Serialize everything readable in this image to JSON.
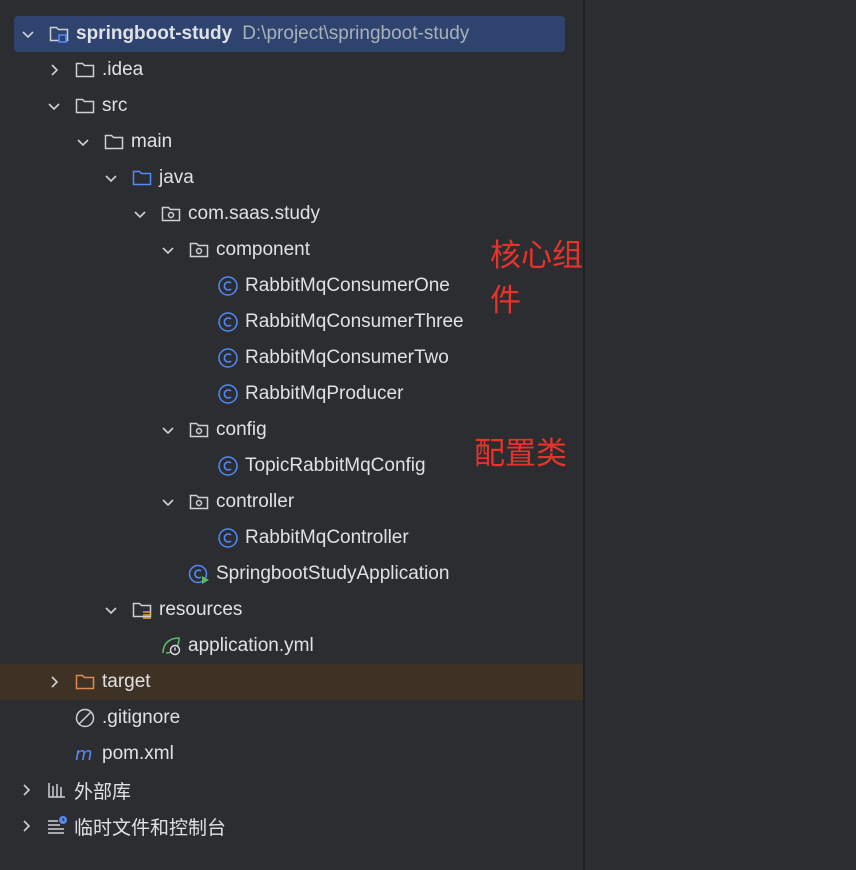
{
  "colors": {
    "background": "#2b2d30",
    "selection": "#2e436e",
    "excluded_row": "#3d3223",
    "folder": "#ced0d6",
    "source_folder": "#548af7",
    "excluded_folder": "#e08855",
    "class_icon": "#548af7",
    "spring": "#5fb864",
    "annotation": "#e8322b"
  },
  "tree": {
    "root": {
      "name": "springboot-study",
      "path": "D:\\project\\springboot-study"
    },
    "idea": ".idea",
    "src": "src",
    "main": "main",
    "java": "java",
    "package": "com.saas.study",
    "component": "component",
    "component_classes": [
      "RabbitMqConsumerOne",
      "RabbitMqConsumerThree",
      "RabbitMqConsumerTwo",
      "RabbitMqProducer"
    ],
    "config": "config",
    "config_classes": [
      "TopicRabbitMqConfig"
    ],
    "controller": "controller",
    "controller_classes": [
      "RabbitMqController"
    ],
    "application_class": "SpringbootStudyApplication",
    "resources": "resources",
    "application_yml": "application.yml",
    "target": "target",
    "gitignore": ".gitignore",
    "pom": "pom.xml",
    "external_libs": "外部库",
    "scratches": "临时文件和控制台"
  },
  "annotations": {
    "component_note": "核心组件",
    "config_note": "配置类"
  }
}
